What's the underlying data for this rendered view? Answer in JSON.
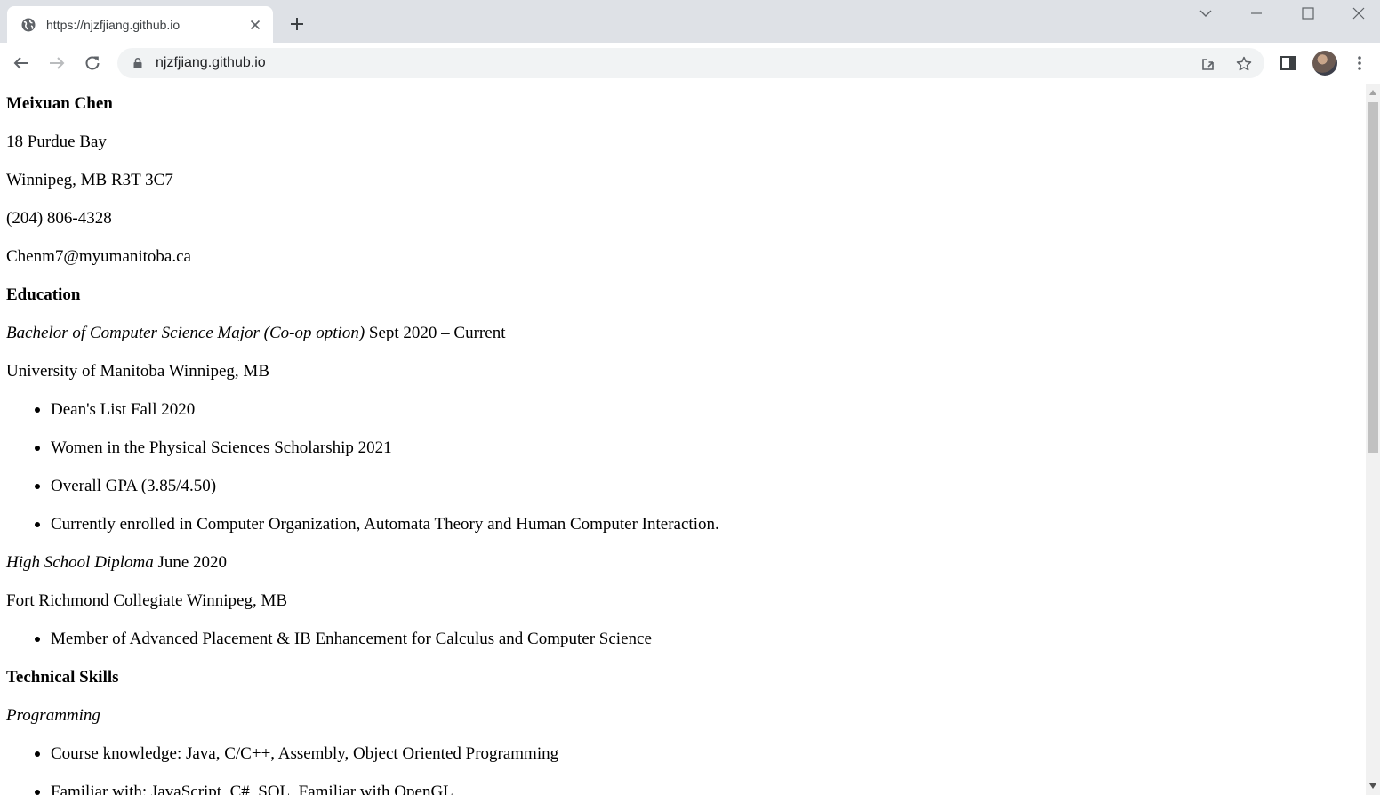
{
  "browser": {
    "tab_title": "https://njzfjiang.github.io",
    "address": "njzfjiang.github.io"
  },
  "resume": {
    "name": "Meixuan Chen",
    "address_line1": "18 Purdue Bay",
    "address_line2": "Winnipeg, MB R3T 3C7",
    "phone": "(204) 806-4328",
    "email": "Chenm7@myumanitoba.ca",
    "education_heading": "Education",
    "degree_title": "Bachelor of Computer Science Major (Co-op option)",
    "degree_dates": " Sept 2020 – Current",
    "university": "University of Manitoba Winnipeg, MB",
    "university_items": [
      "Dean's List Fall 2020",
      "Women in the Physical Sciences Scholarship 2021",
      "Overall GPA (3.85/4.50)",
      "Currently enrolled in Computer Organization, Automata Theory and Human Computer Interaction."
    ],
    "diploma_title": "High School Diploma",
    "diploma_date": " June 2020",
    "high_school": "Fort Richmond Collegiate Winnipeg, MB",
    "high_school_items": [
      "Member of Advanced Placement & IB Enhancement for Calculus and Computer Science"
    ],
    "skills_heading": "Technical Skills",
    "programming_heading": "Programming",
    "programming_items": [
      "Course knowledge: Java, C/C++, Assembly, Object Oriented Programming",
      "Familiar with: JavaScript, C#, SQL, Familiar with OpenGL"
    ]
  }
}
